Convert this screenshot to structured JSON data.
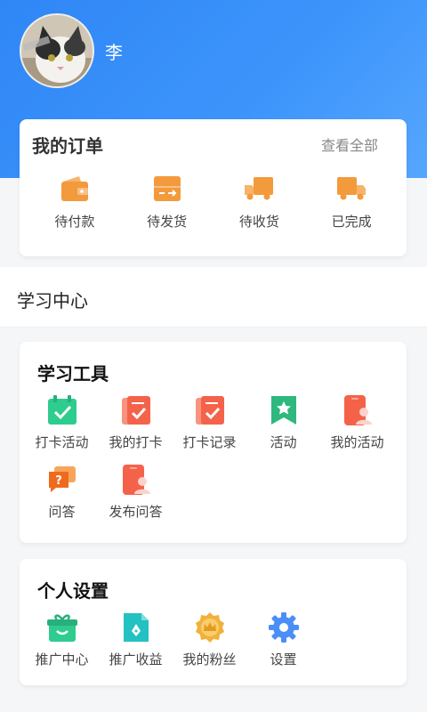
{
  "profile": {
    "name": "李"
  },
  "orders": {
    "title": "我的订单",
    "view_all": "查看全部",
    "items": [
      {
        "label": "待付款",
        "icon": "wallet-icon"
      },
      {
        "label": "待发货",
        "icon": "box-icon"
      },
      {
        "label": "待收货",
        "icon": "truck-icon"
      },
      {
        "label": "已完成",
        "icon": "delivered-truck-icon"
      }
    ],
    "accent": "#f39a3c"
  },
  "learning_center": {
    "title": "学习中心"
  },
  "tools": {
    "title": "学习工具",
    "items": [
      {
        "label": "打卡活动",
        "icon": "calendar-check-icon"
      },
      {
        "label": "我的打卡",
        "icon": "checklist-icon"
      },
      {
        "label": "打卡记录",
        "icon": "record-icon"
      },
      {
        "label": "活动",
        "icon": "bookmark-star-icon"
      },
      {
        "label": "我的活动",
        "icon": "phone-user-icon"
      },
      {
        "label": "问答",
        "icon": "qa-icon"
      },
      {
        "label": "发布问答",
        "icon": "publish-qa-icon"
      }
    ]
  },
  "settings": {
    "title": "个人设置",
    "items": [
      {
        "label": "推广中心",
        "icon": "gift-icon"
      },
      {
        "label": "推广收益",
        "icon": "document-pen-icon"
      },
      {
        "label": "我的粉丝",
        "icon": "crown-badge-icon"
      },
      {
        "label": "设置",
        "icon": "gear-icon"
      }
    ]
  },
  "colors": {
    "header_blue": "#2f86f6",
    "orange": "#f39a3c",
    "green": "#2ecc8f",
    "red": "#f5624a",
    "teal": "#23c1c1",
    "gold": "#f1b13a",
    "blue": "#4a8ff7"
  }
}
